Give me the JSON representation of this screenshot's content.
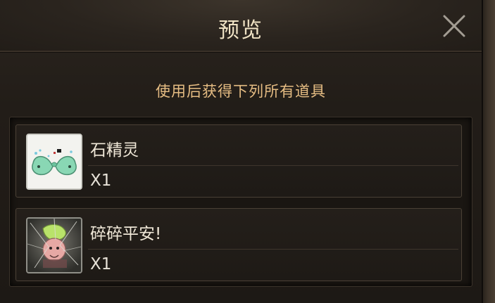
{
  "dialog": {
    "title": "预览",
    "subtitle": "使用后获得下列所有道具"
  },
  "items": [
    {
      "name": "石精灵",
      "qty": "X1",
      "icon": "stone-spirit-icon"
    },
    {
      "name": "碎碎平安!",
      "qty": "X1",
      "icon": "safe-and-sound-icon"
    }
  ]
}
